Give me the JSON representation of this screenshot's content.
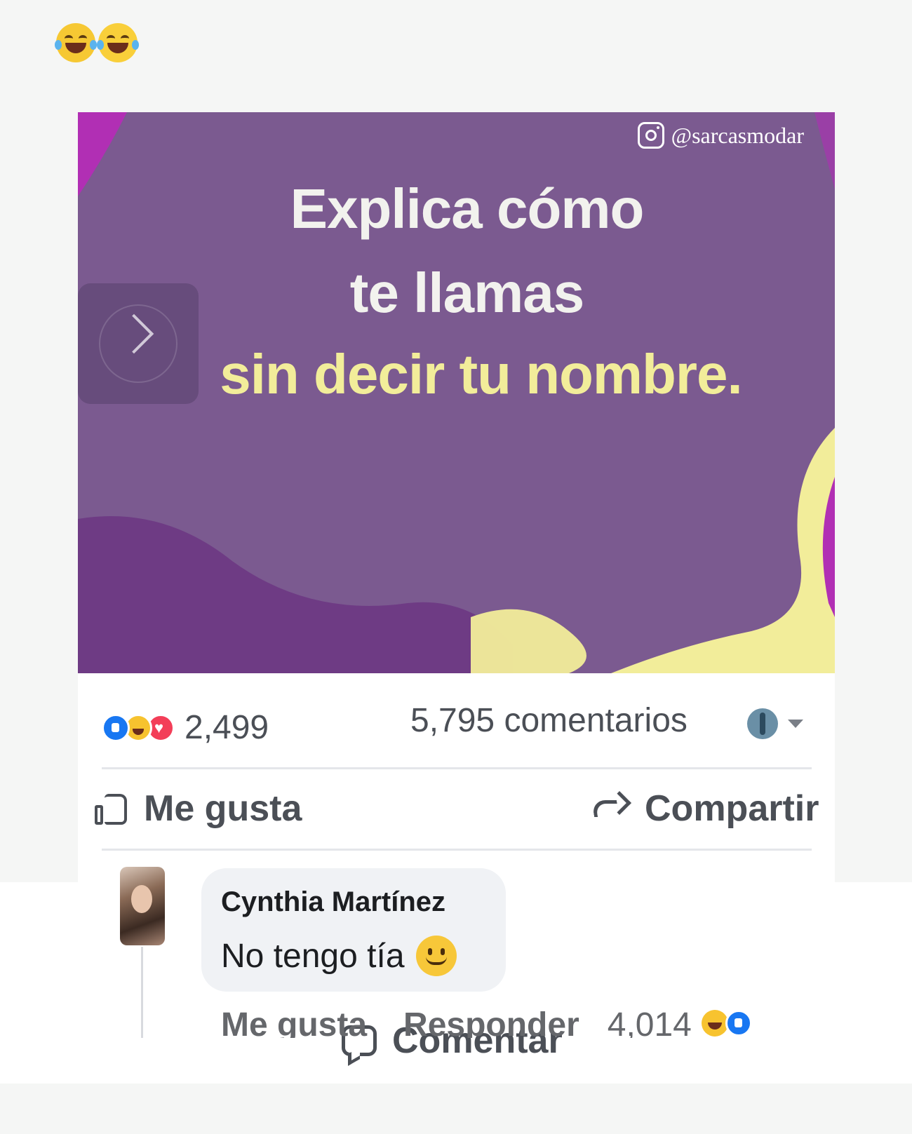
{
  "header": {
    "emojis": [
      "face-with-tears-of-joy",
      "face-with-tears-of-joy"
    ]
  },
  "post_image": {
    "watermark": "@sarcasmodar",
    "headline_line1": "Explica cómo",
    "headline_line2": "te llamas",
    "headline_line3": "sin decir tu nombre.",
    "colors": {
      "background": "#7b5a90",
      "accent_magenta": "#b12fb4",
      "accent_yellow": "#f2ed9a"
    }
  },
  "post_stats": {
    "reactions": [
      "like",
      "haha",
      "love"
    ],
    "reaction_count": "2,499",
    "comment_count": "5,795 comentarios"
  },
  "post_actions": {
    "like_label": "Me gusta",
    "comment_label": "Comentar",
    "share_label": "Compartir"
  },
  "comment": {
    "author": "Cynthia Martínez",
    "text": "No tengo tía",
    "actions": {
      "like_label": "Me gusta",
      "reply_label": "Responder",
      "reaction_count": "4,014"
    }
  }
}
